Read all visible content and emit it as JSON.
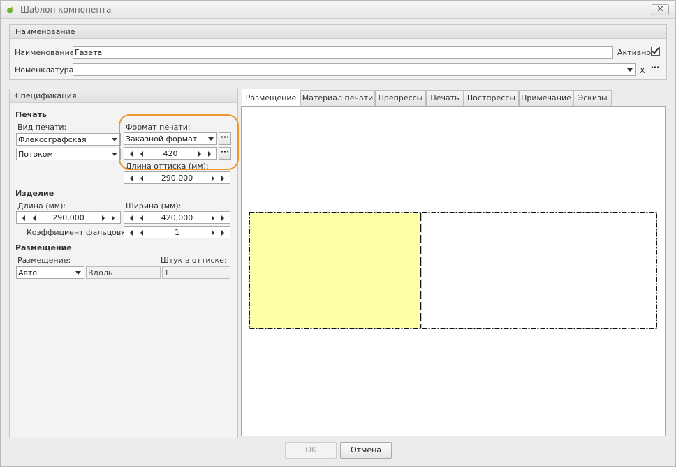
{
  "window": {
    "title": "Шаблон компонента",
    "close_glyph": "✕"
  },
  "naming_group": {
    "header": "Наименование",
    "name_label": "Наименование:",
    "name_value": "Газета",
    "active_label": "Активно",
    "active_checked": true,
    "nomenclature_label": "Номенклатура:",
    "nomenclature_value": "",
    "clear_glyph": "X",
    "dots": "···"
  },
  "spec_group": {
    "header": "Спецификация",
    "print_section": "Печать",
    "print_type_label": "Вид печати:",
    "print_type_value": "Флексографская",
    "feed_value": "Потоком",
    "print_format_label": "Формат печати:",
    "print_format_value": "Заказной формат",
    "format_width": "420",
    "impression_length_label": "Длина оттиска (мм):",
    "impression_length": "290,000",
    "product_section": "Изделие",
    "length_label": "Длина (мм):",
    "length_value": "290,000",
    "width_label": "Ширина (мм):",
    "width_value": "420,000",
    "fold_coef_label": "Коэффициент фальцовки:",
    "fold_coef_value": "1",
    "placement_section": "Размещение",
    "placement_label": "Размещение:",
    "placement_value": "Авто",
    "direction_value": "Вдоль",
    "pieces_label": "Штук в оттиске:",
    "pieces_value": "1",
    "dots": "···"
  },
  "tabs": [
    {
      "label": "Размещение",
      "active": true
    },
    {
      "label": "Материал печати"
    },
    {
      "label": "Препрессы"
    },
    {
      "label": "Печать"
    },
    {
      "label": "Постпрессы"
    },
    {
      "label": "Примечание"
    },
    {
      "label": "Эскизы"
    }
  ],
  "buttons": {
    "ok": "OK",
    "cancel": "Отмена"
  },
  "colors": {
    "product_fill": "#ffffa8",
    "highlight": "#f0952c"
  }
}
